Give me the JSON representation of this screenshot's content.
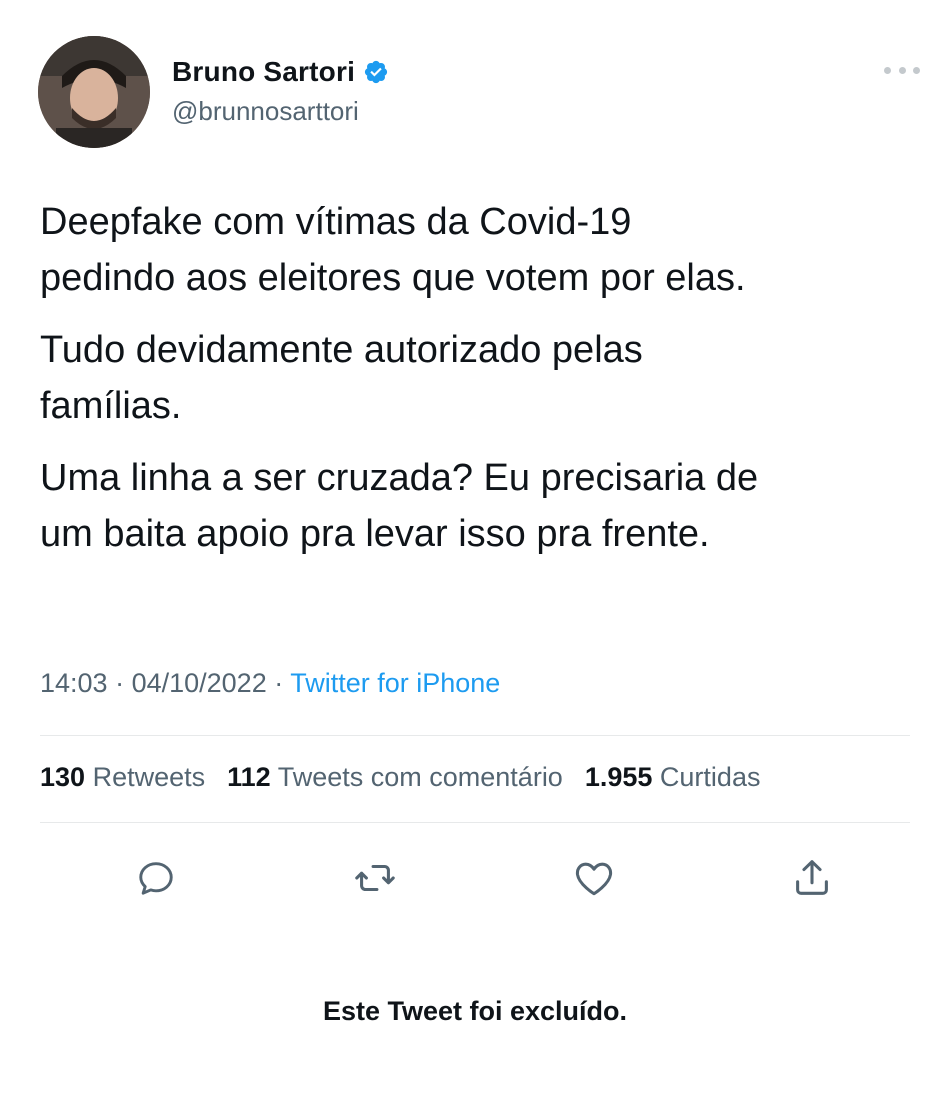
{
  "user": {
    "display_name": "Bruno Sartori",
    "handle": "@brunnosarttori",
    "verified": true
  },
  "tweet": {
    "paragraphs": [
      "Deepfake com vítimas da Covid-19\npedindo aos eleitores que votem por elas.",
      "Tudo devidamente autorizado pelas\nfamílias.",
      "Uma linha a ser cruzada? Eu precisaria de\num baita apoio pra levar isso pra frente."
    ],
    "time": "14:03",
    "separator": " · ",
    "date": "04/10/2022",
    "source": "Twitter for iPhone"
  },
  "stats": {
    "retweets_count": "130",
    "retweets_label": "Retweets",
    "quotes_count": "112",
    "quotes_label": "Tweets com comentário",
    "likes_count": "1.955",
    "likes_label": "Curtidas"
  },
  "status_message": "Este Tweet foi excluído.",
  "icons": {
    "more": "more-horizontal-icon",
    "reply": "reply-icon",
    "retweet": "retweet-icon",
    "like": "heart-icon",
    "share": "share-icon",
    "verified": "verified-badge-icon"
  },
  "colors": {
    "text": "#0f1419",
    "secondary": "#536471",
    "accent": "#1d9bf0"
  }
}
